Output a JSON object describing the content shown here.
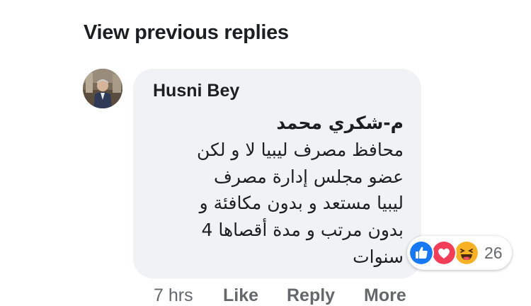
{
  "thread": {
    "view_previous_label": "View previous replies"
  },
  "comment": {
    "author": "Husni Bey",
    "lines": [
      "م-شكري محمد",
      "محافظ مصرف ليبيا لا و لكن",
      "عضو مجلس إدارة مصرف",
      "ليبيا مستعد و بدون مكافئة و",
      "بدون مرتب و مدة أقصاها 4",
      "سنوات"
    ],
    "reactions": {
      "types": [
        "like-icon",
        "love-icon",
        "haha-icon"
      ],
      "count": "26",
      "colors": {
        "like": "#1877f2",
        "love": "#f33e58",
        "haha": "#f7b125"
      }
    },
    "meta": {
      "time": "7 hrs",
      "like_label": "Like",
      "reply_label": "Reply",
      "more_label": "More"
    }
  },
  "colors": {
    "bubble_bg": "#f0f2f5",
    "text_primary": "#1c1e21",
    "text_secondary": "#65676b"
  }
}
